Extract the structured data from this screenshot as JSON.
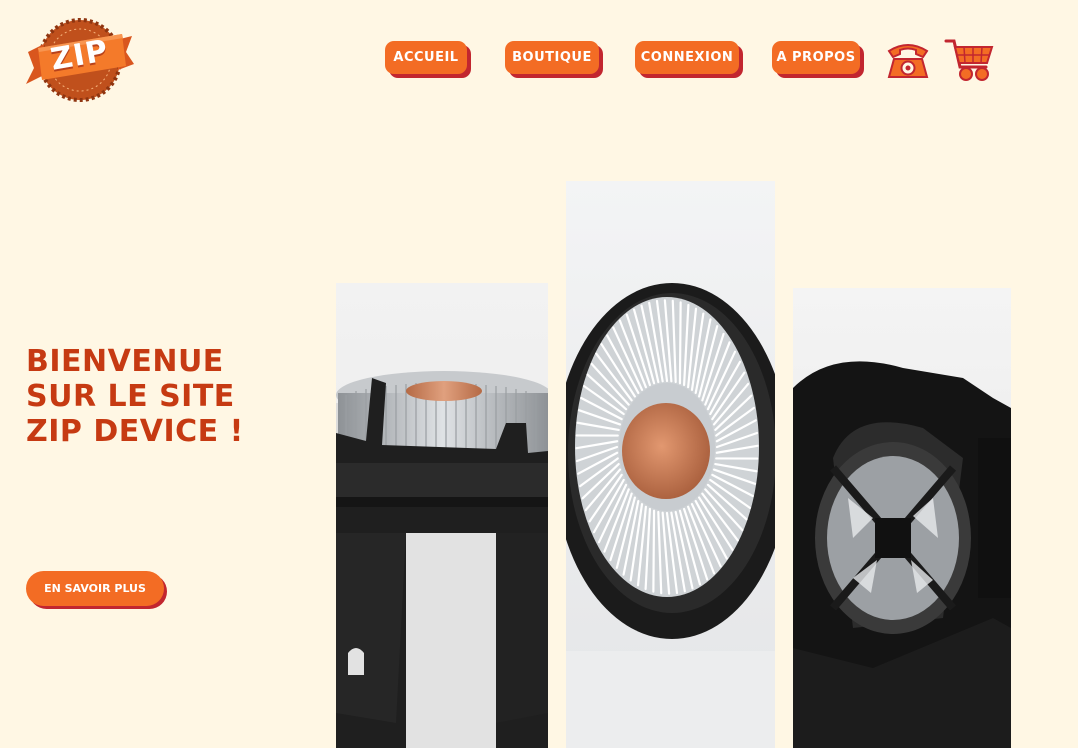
{
  "brand": {
    "logo_text": "ZIP"
  },
  "nav": {
    "items": [
      {
        "label": "ACCUEIL"
      },
      {
        "label": "BOUTIQUE"
      },
      {
        "label": "CONNEXION"
      },
      {
        "label": "A PROPOS"
      }
    ],
    "icons": {
      "phone": "phone-icon",
      "cart": "cart-icon"
    }
  },
  "hero": {
    "title": "BIENVENUE SUR LE SITE ZIP DEVICE !",
    "cta_label": "EN SAVOIR PLUS"
  },
  "gallery": {
    "images": [
      "cpu-cooler-side-photo",
      "cpu-cooler-top-photo",
      "fan-housing-photo"
    ]
  },
  "colors": {
    "background": "#fff7e4",
    "accent": "#f36c24",
    "accent_shadow": "#c2262f",
    "title": "#c63a12"
  }
}
